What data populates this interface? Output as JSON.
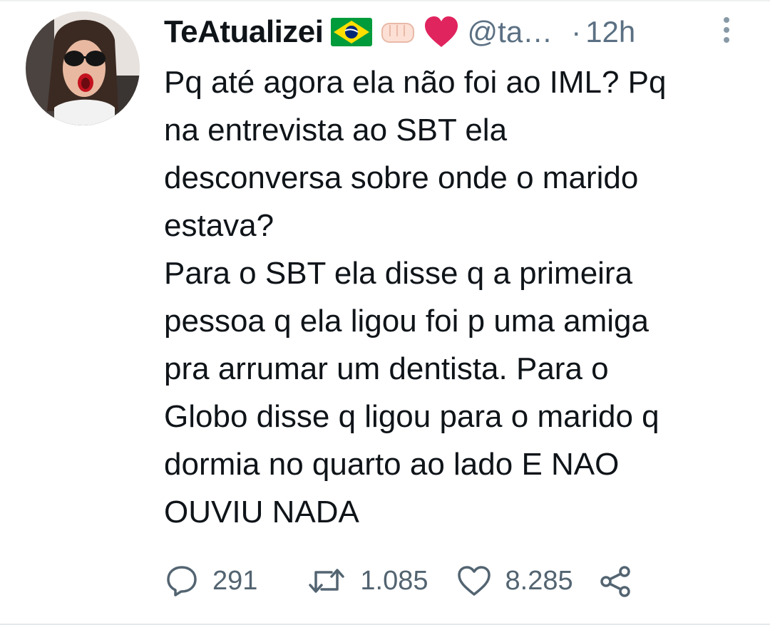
{
  "tweet": {
    "author": {
      "display_name": "TeAtualizei",
      "handle": "@ta…",
      "avatar_icon": "user-avatar-photo",
      "name_emojis": [
        "brazil-flag-icon",
        "fist-icon",
        "red-heart-icon"
      ]
    },
    "separator": "·",
    "timestamp": "12h",
    "more_icon": "vertical-dots-icon",
    "text": "Pq até agora ela não foi ao IML? Pq\nna entrevista ao SBT ela\ndesconversa sobre onde o marido\nestava?\nPara o SBT ela disse q a primeira\npessoa q ela ligou foi p uma amiga\npra arrumar um dentista. Para o\nGlobo disse q ligou para o marido q\ndormia no quarto ao lado E NAO\nOUVIU NADA",
    "actions": {
      "reply": {
        "icon": "reply-bubble-icon",
        "count": "291"
      },
      "retweet": {
        "icon": "retweet-icon",
        "count": "1.085"
      },
      "like": {
        "icon": "heart-outline-icon",
        "count": "8.285"
      },
      "share": {
        "icon": "share-icon"
      }
    }
  },
  "colors": {
    "text_primary": "#0f1419",
    "text_secondary": "#5b7083",
    "heart_red": "#e0245e",
    "flag_green": "#009c3b",
    "flag_yellow": "#ffdf00",
    "flag_blue": "#002776"
  }
}
